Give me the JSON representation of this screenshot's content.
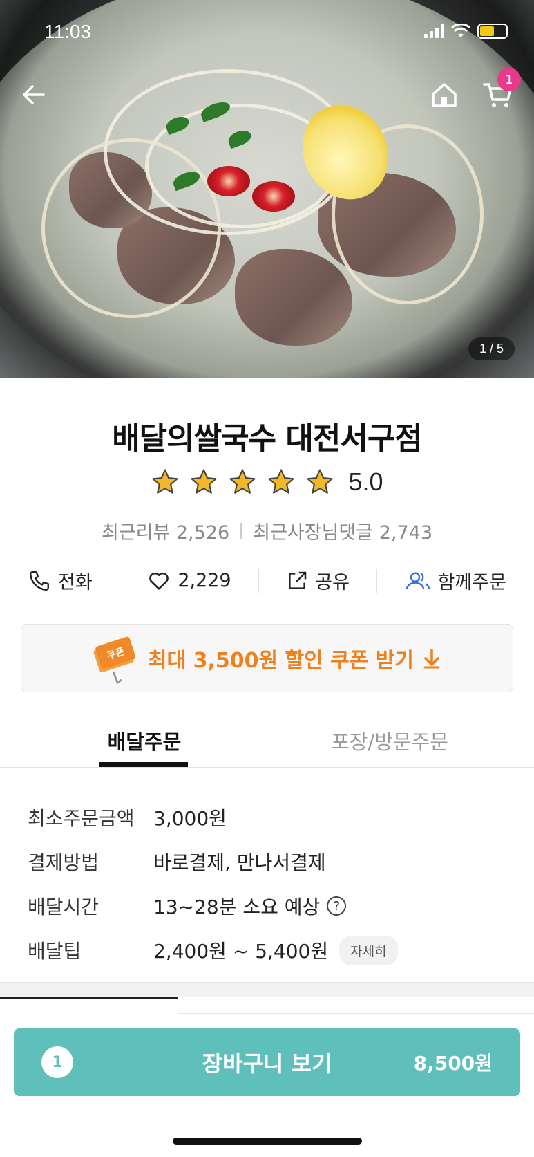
{
  "status_bar": {
    "time": "11:03"
  },
  "hero": {
    "image_counter": "1 / 5"
  },
  "top_nav": {
    "cart_badge": "1"
  },
  "store": {
    "name": "배달의쌀국수 대전서구점",
    "rating": "5.0",
    "stars": 5,
    "recent_reviews": "최근리뷰 2,526",
    "owner_replies": "최근사장님댓글 2,743"
  },
  "actions": [
    {
      "label": "전화",
      "icon": "phone-icon"
    },
    {
      "label": "2,229",
      "icon": "heart-icon"
    },
    {
      "label": "공유",
      "icon": "share-icon"
    },
    {
      "label": "함께주문",
      "icon": "group-order-icon"
    }
  ],
  "coupon": {
    "text": "최대 3,500원 할인 쿠폰 받기",
    "icon_label": "쿠폰"
  },
  "tabs": [
    {
      "label": "배달주문",
      "active": true
    },
    {
      "label": "포장/방문주문",
      "active": false
    }
  ],
  "info": [
    {
      "label": "최소주문금액",
      "value": "3,000원"
    },
    {
      "label": "결제방법",
      "value": "바로결제, 만나서결제"
    },
    {
      "label": "배달시간",
      "value": "13~28분 소요 예상"
    },
    {
      "label": "배달팁",
      "value": "2,400원 ~ 5,400원",
      "chip": "자세히"
    }
  ],
  "cart_button": {
    "count": "1",
    "label": "장바구니 보기",
    "price": "8,500원"
  },
  "colors": {
    "accent_teal": "#5ebfbb",
    "coupon_orange": "#f07f1e",
    "badge_pink": "#e8398b",
    "star_gold": "#f2b82a"
  }
}
